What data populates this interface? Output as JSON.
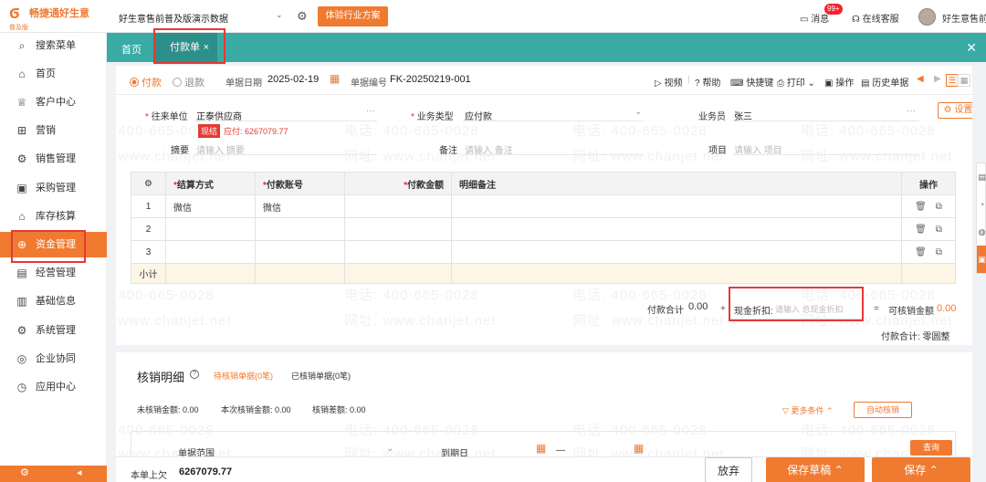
{
  "topbar": {
    "brand": "畅捷通好生意",
    "edition": "普及版",
    "account": "好生意售前普及版演示数据",
    "trial_button": "体验行业方案",
    "message_label": "消息",
    "message_badge": "99+",
    "service_label": "在线客服",
    "user_name": "好生意售前"
  },
  "sidebar": {
    "items": [
      {
        "label": "搜索菜单",
        "icon": "search-menu-icon",
        "glyph": "⌕"
      },
      {
        "label": "首页",
        "icon": "home-icon",
        "glyph": "⌂"
      },
      {
        "label": "客户中心",
        "icon": "trophy-icon",
        "glyph": "♕"
      },
      {
        "label": "营销",
        "icon": "gift-icon",
        "glyph": "⊞"
      },
      {
        "label": "销售管理",
        "icon": "sales-icon",
        "glyph": "⚙"
      },
      {
        "label": "采购管理",
        "icon": "purchase-icon",
        "glyph": "▣"
      },
      {
        "label": "库存核算",
        "icon": "inventory-icon",
        "glyph": "⌂"
      },
      {
        "label": "资金管理",
        "icon": "funds-icon",
        "glyph": "⊕"
      },
      {
        "label": "经营管理",
        "icon": "operations-icon",
        "glyph": "▤"
      },
      {
        "label": "基础信息",
        "icon": "basic-info-icon",
        "glyph": "▥"
      },
      {
        "label": "系统管理",
        "icon": "system-icon",
        "glyph": "⚙"
      },
      {
        "label": "企业协同",
        "icon": "collaboration-icon",
        "glyph": "◎"
      },
      {
        "label": "应用中心",
        "icon": "app-center-icon",
        "glyph": "◷"
      }
    ]
  },
  "tabs": {
    "home": "首页",
    "active": "付款单",
    "close": "×"
  },
  "toolbar": {
    "radio_pay": "付款",
    "radio_refund": "退款",
    "date_label": "单据日期",
    "date_value": "2025-02-19",
    "no_label": "单据编号",
    "no_value": "FK-20250219-001",
    "video": "视频",
    "help": "帮助",
    "shortcut": "快捷键",
    "print": "打印",
    "operate": "操作",
    "history": "历史单据"
  },
  "form": {
    "counterparty_label": "往来单位",
    "counterparty_value": "正泰供应商",
    "cash_tag": "现结",
    "paid_text": "应付: 6267079.77",
    "biz_type_label": "业务类型",
    "biz_type_value": "应付款",
    "salesman_label": "业务员",
    "salesman_value": "张三",
    "settings_button": "设置",
    "summary_label": "摘要",
    "summary_placeholder": "请输入 摘要",
    "note_label": "备注",
    "note_placeholder": "请输入 备注",
    "project_label": "项目",
    "project_placeholder": "请输入 项目"
  },
  "grid": {
    "headers": [
      "结算方式",
      "付款账号",
      "付款金额",
      "明细备注",
      "操作"
    ],
    "rows": [
      {
        "no": "1",
        "method": "微信",
        "account": "微信"
      },
      {
        "no": "2",
        "method": "",
        "account": ""
      },
      {
        "no": "3",
        "method": "",
        "account": ""
      }
    ],
    "subtotal_label": "小计"
  },
  "totals": {
    "pay_total_label": "付款合计",
    "pay_total_value": "0.00",
    "plus": "+",
    "discount_label": "现金折扣:",
    "discount_placeholder": "请输入 总现金折扣",
    "eq": "=",
    "writeoff_label": "可核销金额",
    "writeoff_value": "0.00",
    "pay_total_cn": "付款合计: 零圆整"
  },
  "writeoff": {
    "title": "核销明细",
    "tab_pending": "待核销单据(0笔)",
    "tab_done": "已核销单据(0笔)",
    "stat_writeoff": "未核销金额: 0.00",
    "stat_this": "本次核销金额: 0.00",
    "stat_diff": "核销差额: 0.00",
    "more_conditions": "更多条件",
    "auto_button": "自动核销",
    "query_button": "查询",
    "filter_range": "单据范围",
    "filter_due": "到期日",
    "filter_dash": "—"
  },
  "footer": {
    "owed_label": "本单上欠",
    "owed_value": "6267079.77",
    "discard": "放弃",
    "save_draft": "保存草稿",
    "save": "保存"
  },
  "watermark": {
    "phone": "电话: 400-665-0028",
    "site": "网址: www.chanjet.net"
  },
  "colors": {
    "accent": "#f07a30",
    "tabbar": "#3aaba4",
    "tab_active": "#2d8f89",
    "highlight_box": "#e53935"
  }
}
